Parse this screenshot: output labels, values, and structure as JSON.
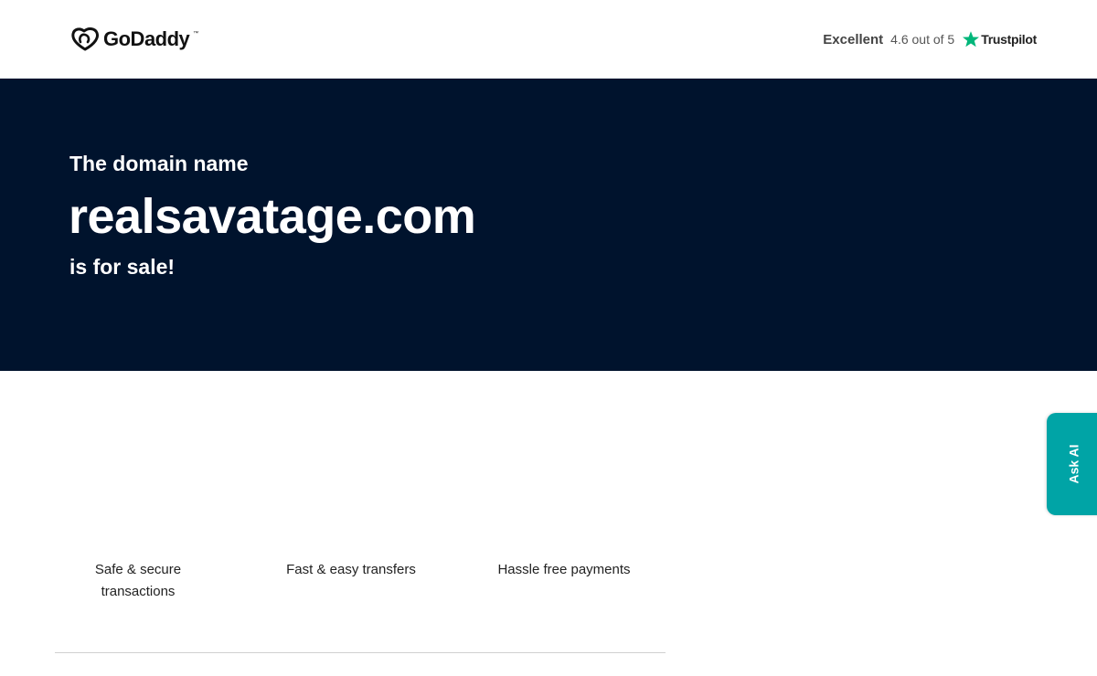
{
  "header": {
    "logo_text": "GoDaddy",
    "logo_icon": "godaddy-logo-icon",
    "rating": {
      "label": "Excellent",
      "score": "4.6 out of 5",
      "provider": "Trustpilot",
      "star_color": "#00b67a"
    }
  },
  "hero": {
    "pre": "The domain name",
    "domain": "realsavatage.com",
    "post": "is for sale!",
    "background": "#00132d"
  },
  "features": [
    {
      "label": "Safe & secure transactions"
    },
    {
      "label": "Fast & easy transfers"
    },
    {
      "label": "Hassle free payments"
    }
  ],
  "ask_ai": {
    "label": "Ask AI",
    "color": "#00a4a6"
  }
}
